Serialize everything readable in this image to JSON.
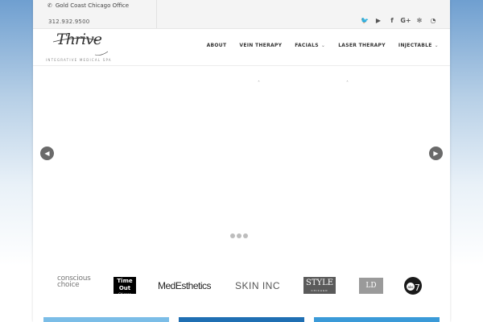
{
  "topbar": {
    "office": "Gold Coast Chicago Office",
    "phone": "312.932.9500",
    "social": [
      {
        "icon": "twitter-icon",
        "glyph": "🐦"
      },
      {
        "icon": "youtube-icon",
        "glyph": "▶"
      },
      {
        "icon": "facebook-icon",
        "glyph": "f"
      },
      {
        "icon": "google-plus-icon",
        "glyph": "G+"
      },
      {
        "icon": "yelp-icon",
        "glyph": "✻"
      },
      {
        "icon": "rss-icon",
        "glyph": "◔"
      }
    ]
  },
  "logo": {
    "script": "Thrive",
    "subtitle": "INTEGRATIVE MEDICAL SPA"
  },
  "nav": {
    "items": [
      {
        "label": "ABOUT",
        "dropdown": false
      },
      {
        "label": "VEIN THERAPY",
        "dropdown": false
      },
      {
        "label": "FACIALS",
        "dropdown": true
      },
      {
        "label": "LASER THERAPY",
        "dropdown": false
      },
      {
        "label": "INJECTABLE",
        "dropdown": true
      }
    ]
  },
  "slider": {
    "prev_glyph": "◀",
    "next_glyph": "▶",
    "slide_count": 3
  },
  "press": {
    "conscious": [
      "conscious",
      "choice"
    ],
    "timeout": [
      "Time Out",
      "Chicago"
    ],
    "medesthetics": "MedEsthetics",
    "skininc": "SKIN INC",
    "style": [
      "STYLE",
      "CHICAGO"
    ],
    "ld": "LD",
    "abc": "abc 7"
  },
  "colors": {
    "box1": "#7bbde7",
    "box2": "#1f6fb3",
    "box3": "#3a9ad8"
  }
}
